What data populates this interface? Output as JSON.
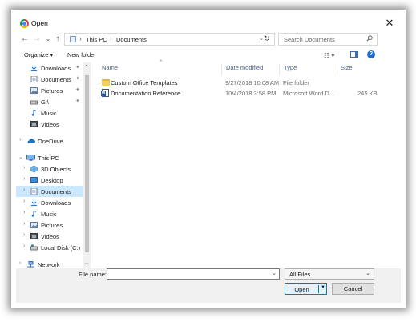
{
  "window": {
    "title": "Open",
    "close_glyph": "✕"
  },
  "nav_buttons": {
    "back": "←",
    "forward": "→",
    "recent": "⌄",
    "up": "↑"
  },
  "address": {
    "crumbs": [
      "This PC",
      "Documents"
    ],
    "separator": "›"
  },
  "search": {
    "placeholder": "Search Documents"
  },
  "toolbar": {
    "organize": "Organize ▾",
    "new_folder": "New folder"
  },
  "nav_pane": {
    "items": [
      {
        "label": "Downloads",
        "icon": "download-arrow-icon",
        "pinned": true
      },
      {
        "label": "Documents",
        "icon": "document-icon",
        "pinned": true
      },
      {
        "label": "Pictures",
        "icon": "pictures-icon",
        "pinned": true
      },
      {
        "label": "G:\\",
        "icon": "drive-icon",
        "pinned": true
      },
      {
        "label": "Music",
        "icon": "music-note-icon",
        "pinned": false
      },
      {
        "label": "Videos",
        "icon": "video-icon",
        "pinned": false
      },
      {
        "label": "OneDrive",
        "icon": "cloud-icon",
        "pinned": false
      },
      {
        "label": "This PC",
        "icon": "computer-icon",
        "pinned": false
      },
      {
        "label": "3D Objects",
        "icon": "cube-icon",
        "pinned": false
      },
      {
        "label": "Desktop",
        "icon": "desktop-icon",
        "pinned": false
      },
      {
        "label": "Documents",
        "icon": "document-icon",
        "pinned": false,
        "selected": true
      },
      {
        "label": "Downloads",
        "icon": "download-arrow-icon",
        "pinned": false
      },
      {
        "label": "Music",
        "icon": "music-note-icon",
        "pinned": false
      },
      {
        "label": "Pictures",
        "icon": "pictures-icon",
        "pinned": false
      },
      {
        "label": "Videos",
        "icon": "video-icon",
        "pinned": false
      },
      {
        "label": "Local Disk (C:)",
        "icon": "disk-icon",
        "pinned": false
      },
      {
        "label": "Network",
        "icon": "network-icon",
        "pinned": false
      }
    ]
  },
  "columns": {
    "name": "Name",
    "date": "Date modified",
    "type": "Type",
    "size": "Size"
  },
  "files": [
    {
      "name": "Custom Office Templates",
      "date": "9/27/2018 10:08 AM",
      "type": "File folder",
      "size": "",
      "icon": "folder-icon"
    },
    {
      "name": "Documentation Reference",
      "date": "10/4/2018 3:58 PM",
      "type": "Microsoft Word D...",
      "size": "245 KB",
      "icon": "word-document-icon"
    }
  ],
  "bottom": {
    "file_name_label": "File name:",
    "file_name_value": "",
    "file_type": "All Files",
    "open_label": "Open",
    "cancel_label": "Cancel"
  }
}
